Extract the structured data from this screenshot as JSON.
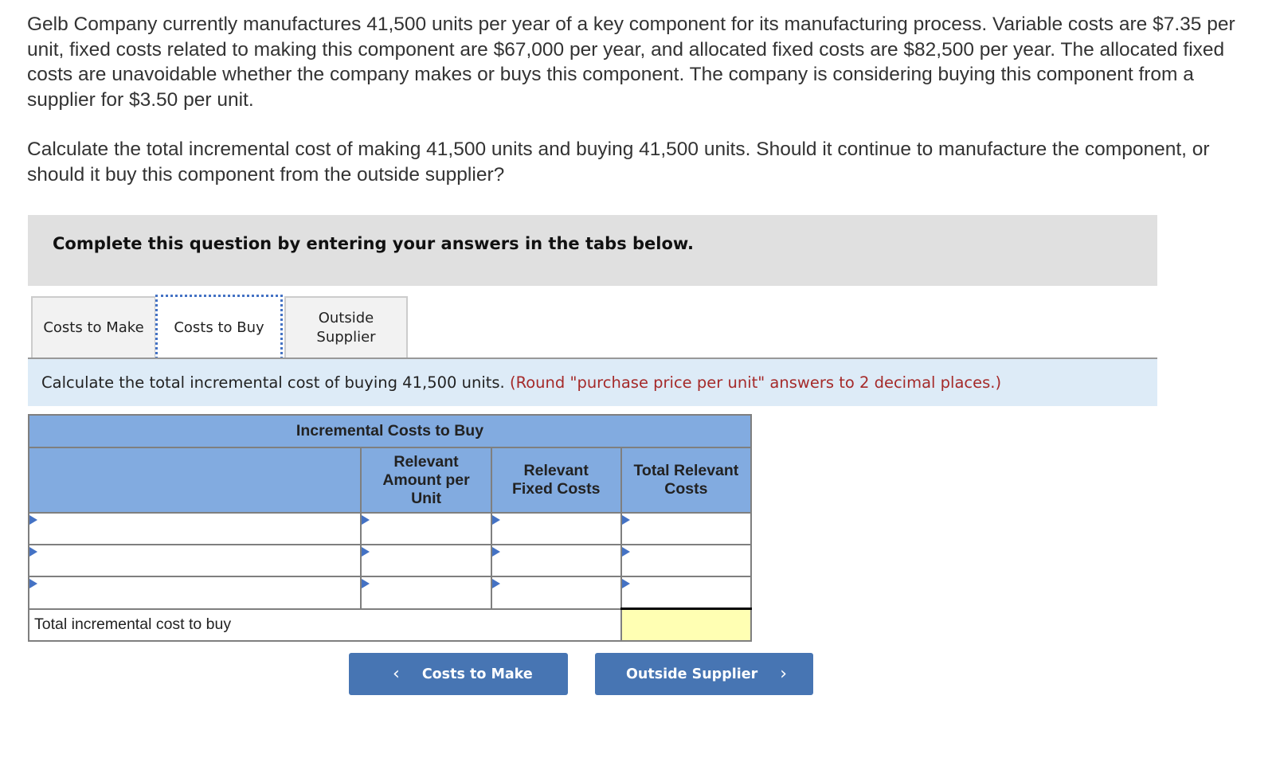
{
  "question": {
    "paragraph1": "Gelb Company currently manufactures 41,500 units per year of a key component for its manufacturing process. Variable costs are $7.35 per unit, fixed costs related to making this component are $67,000 per year, and allocated fixed costs are $82,500 per year. The allocated fixed costs are unavoidable whether the company makes or buys this component. The company is considering buying this component from a supplier for $3.50 per unit.",
    "paragraph2": "Calculate the total incremental cost of making 41,500 units and buying 41,500 units. Should it continue to manufacture the component, or should it buy this component from the outside supplier?"
  },
  "instructions": "Complete this question by entering your answers in the tabs below.",
  "tabs": [
    {
      "label": "Costs to Make",
      "active": false
    },
    {
      "label": "Costs to Buy",
      "active": true
    },
    {
      "label": "Outside Supplier",
      "active": false
    }
  ],
  "prompt": {
    "text": "Calculate the total incremental cost of buying 41,500 units.",
    "note": "(Round \"purchase price per unit\" answers to 2 decimal places.)"
  },
  "table": {
    "title": "Incremental Costs to Buy",
    "columns": [
      "",
      "Relevant Amount per Unit",
      "Relevant Fixed Costs",
      "Total Relevant Costs"
    ],
    "rows": [
      [
        "",
        "",
        "",
        ""
      ],
      [
        "",
        "",
        "",
        ""
      ],
      [
        "",
        "",
        "",
        ""
      ]
    ],
    "total_label": "Total incremental cost to buy",
    "total_value": ""
  },
  "nav": {
    "prev_label": "Costs to Make",
    "next_label": "Outside Supplier",
    "prev_icon": "‹",
    "next_icon": "›"
  },
  "colors": {
    "header_blue": "#82abe0",
    "button_blue": "#4775b3",
    "note_red": "#a52a2a",
    "total_yellow": "#ffffb3"
  }
}
